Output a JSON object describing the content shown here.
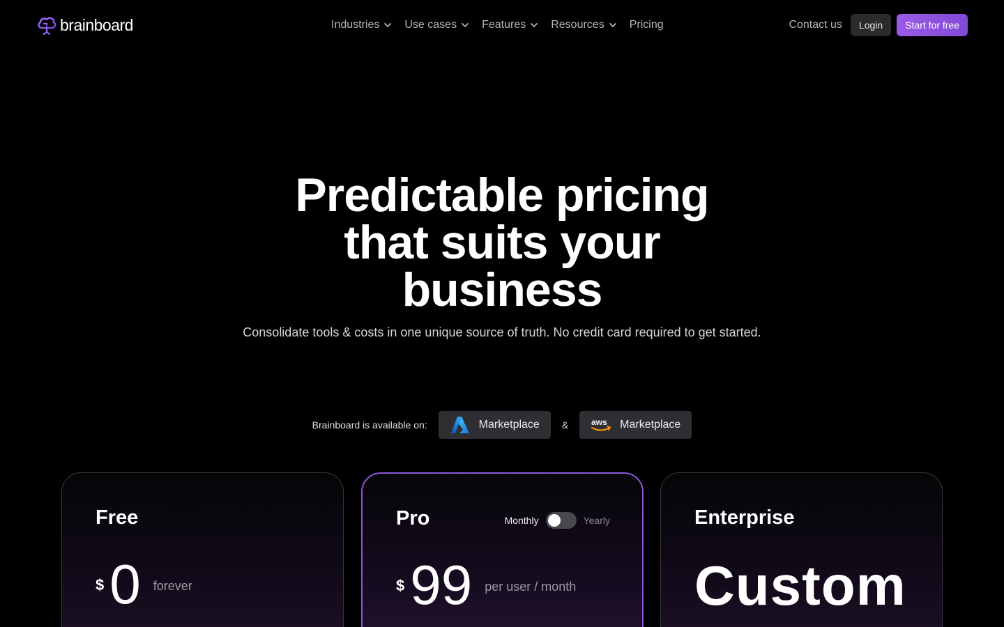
{
  "brand": {
    "name": "brainboard",
    "accent": "#8b5cf6"
  },
  "nav": {
    "links": [
      {
        "label": "Industries",
        "has_dropdown": true
      },
      {
        "label": "Use cases",
        "has_dropdown": true
      },
      {
        "label": "Features",
        "has_dropdown": true
      },
      {
        "label": "Resources",
        "has_dropdown": true
      },
      {
        "label": "Pricing",
        "has_dropdown": false
      }
    ],
    "contact_label": "Contact us",
    "login_label": "Login",
    "start_label": "Start for free"
  },
  "hero": {
    "title_lines": [
      "Predictable pricing",
      "that suits your",
      "business"
    ],
    "subtitle": "Consolidate tools & costs in one unique source of truth. No credit card required to get started."
  },
  "availability": {
    "label": "Brainboard is available on:",
    "azure_label": "Marketplace",
    "separator": "&",
    "aws_label": "Marketplace",
    "aws_logo_text": "aws"
  },
  "plans": {
    "free": {
      "name": "Free",
      "currency": "$",
      "amount": "0",
      "unit": "forever"
    },
    "pro": {
      "name": "Pro",
      "currency": "$",
      "amount": "99",
      "unit": "per user / month",
      "toggle": {
        "left": "Monthly",
        "right": "Yearly",
        "selected": "Monthly"
      }
    },
    "enterprise": {
      "name": "Enterprise",
      "price": "Custom"
    }
  }
}
